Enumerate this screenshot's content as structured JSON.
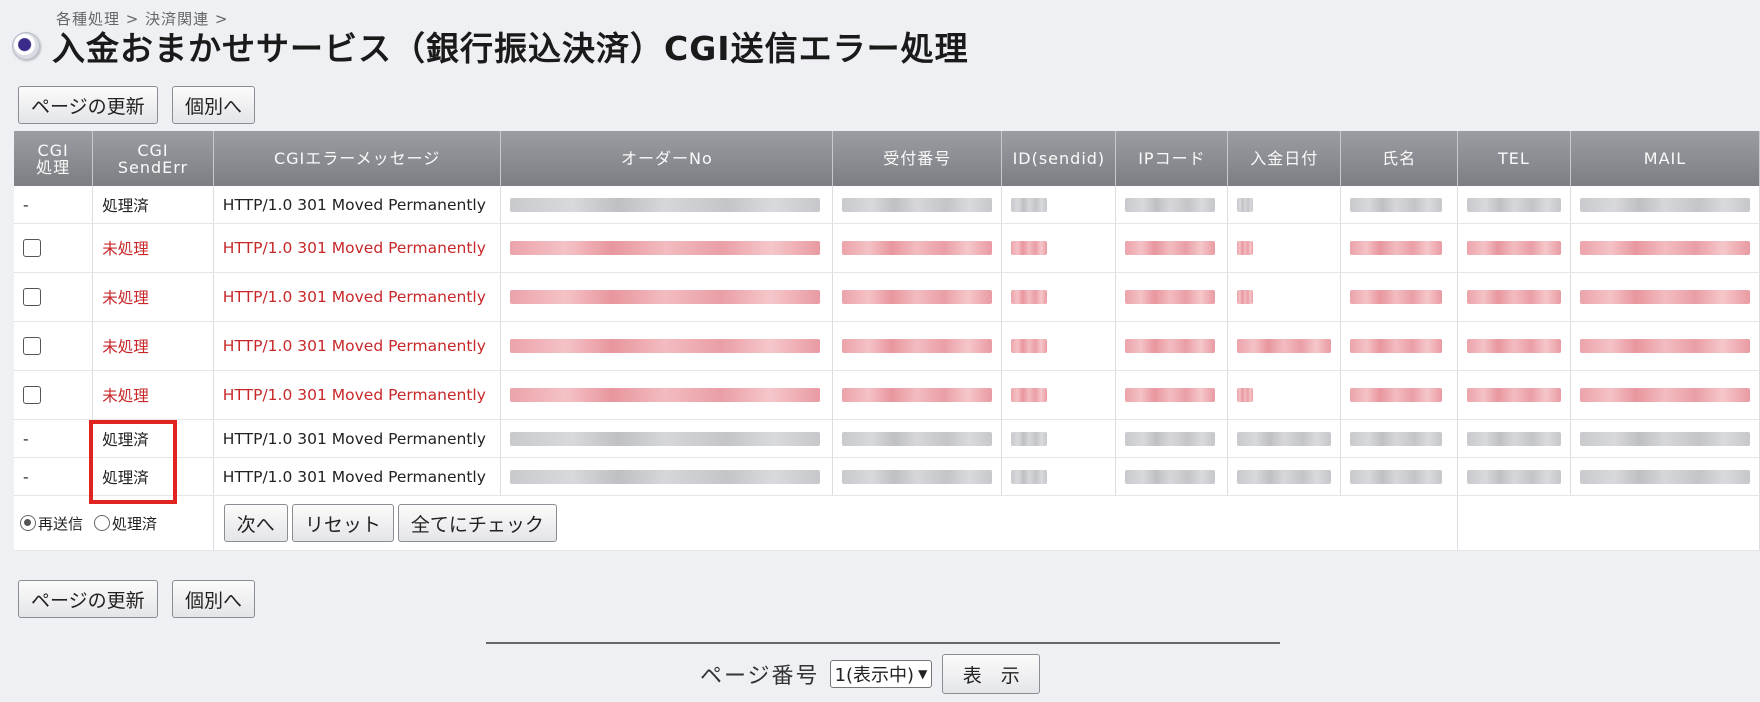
{
  "breadcrumb": "各種処理 > 決済関連 >",
  "page_title": "入金おまかせサービス（銀行振込決済）CGI送信エラー処理",
  "buttons": {
    "refresh": "ページの更新",
    "individual": "個別へ"
  },
  "table": {
    "headers": {
      "cgi_process": "CGI\n処理",
      "cgi_senderr": "CGI\nSendErr",
      "cgi_error_message": "CGIエラーメッセージ",
      "order_no": "オーダーNo",
      "receipt_no": "受付番号",
      "sendid": "ID(sendid)",
      "ip_code": "IPコード",
      "deposit_date": "入金日付",
      "name": "氏名",
      "tel": "TEL",
      "mail": "MAIL"
    },
    "rows": [
      {
        "cgi": "-",
        "status": "処理済",
        "message": "HTTP/1.0 301 Moved Permanently",
        "error": false
      },
      {
        "cgi": "checkbox",
        "status": "未処理",
        "message": "HTTP/1.0 301 Moved Permanently",
        "error": true
      },
      {
        "cgi": "checkbox",
        "status": "未処理",
        "message": "HTTP/1.0 301 Moved Permanently",
        "error": true
      },
      {
        "cgi": "checkbox",
        "status": "未処理",
        "message": "HTTP/1.0 301 Moved Permanently",
        "error": true
      },
      {
        "cgi": "checkbox",
        "status": "未処理",
        "message": "HTTP/1.0 301 Moved Permanently",
        "error": true
      },
      {
        "cgi": "-",
        "status": "処理済",
        "message": "HTTP/1.0 301 Moved Permanently",
        "error": false
      },
      {
        "cgi": "-",
        "status": "処理済",
        "message": "HTTP/1.0 301 Moved Permanently",
        "error": false
      }
    ]
  },
  "actions": {
    "radio_resend": "再送信",
    "radio_processed": "処理済",
    "next": "次へ",
    "reset": "リセット",
    "check_all": "全てにチェック"
  },
  "pager": {
    "label": "ページ番号",
    "selected_option": "1(表示中)",
    "show_button": "表　示"
  },
  "colors": {
    "error_text": "#c8282a",
    "highlight": "#e02420"
  }
}
